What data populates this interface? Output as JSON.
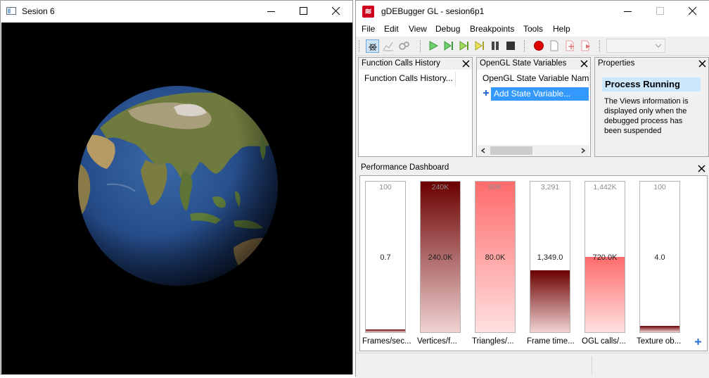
{
  "window1": {
    "title": "Sesion 6"
  },
  "window2": {
    "title": "gDEBugger GL - sesion6p1",
    "menu": [
      "File",
      "Edit",
      "View",
      "Debug",
      "Breakpoints",
      "Tools",
      "Help"
    ],
    "panes": {
      "function_calls": {
        "title": "Function Calls History",
        "column": "Function Calls History..."
      },
      "state_vars": {
        "title": "OpenGL State Variables",
        "column": "OpenGL State Variable Name",
        "add_item": "Add State Variable..."
      },
      "properties": {
        "title": "Properties",
        "heading": "Process Running",
        "lines": [
          "The Views information is",
          "displayed only when the",
          "debugged process has",
          "been suspended"
        ]
      }
    },
    "dashboard": {
      "title": "Performance Dashboard",
      "counters": [
        {
          "name": "Frames/sec...",
          "max": "100",
          "value": "0.7",
          "fraction": 0.007,
          "color": "dark"
        },
        {
          "name": "Vertices/f...",
          "max": "240K",
          "value": "240.0K",
          "fraction": 1.0,
          "color": "dark"
        },
        {
          "name": "Triangles/...",
          "max": "80K",
          "value": "80.0K",
          "fraction": 1.0,
          "color": "light"
        },
        {
          "name": "Frame time...",
          "max": "3,291",
          "value": "1,349.0",
          "fraction": 0.41,
          "color": "dark"
        },
        {
          "name": "OGL calls/...",
          "max": "1,442K",
          "value": "720.0K",
          "fraction": 0.5,
          "color": "light"
        },
        {
          "name": "Texture ob...",
          "max": "100",
          "value": "4.0",
          "fraction": 0.04,
          "color": "dark"
        }
      ]
    }
  },
  "colors": {
    "selection": "#3399ff",
    "dark_bar_top": "#6b0000",
    "dark_bar_bottom": "#f0d2d2",
    "light_bar_top": "#ff6b6b",
    "light_bar_bottom": "#ffe0e0",
    "banner": "#cce8ff"
  }
}
